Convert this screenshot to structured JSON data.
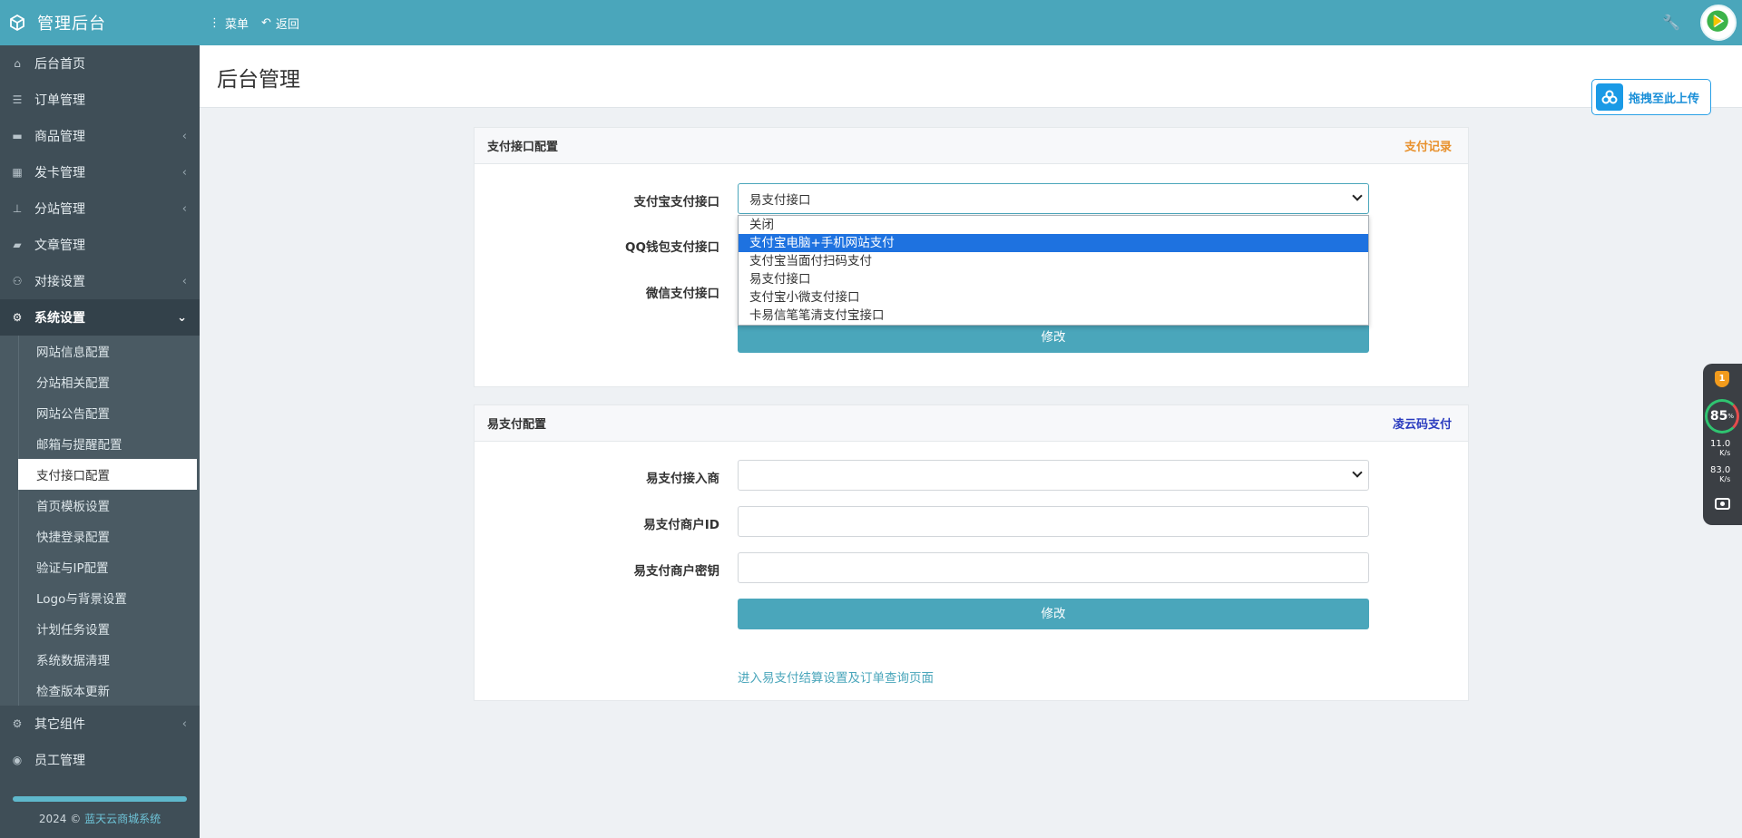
{
  "header": {
    "brand": "管理后台",
    "menu_label": "菜单",
    "back_label": "返回"
  },
  "sidebar": {
    "items_top": [
      {
        "label": "后台首页",
        "icon": "home-icon"
      },
      {
        "label": "订单管理",
        "icon": "list-icon"
      },
      {
        "label": "商品管理",
        "icon": "cart-icon",
        "expandable": true
      },
      {
        "label": "发卡管理",
        "icon": "grid-icon",
        "expandable": true
      },
      {
        "label": "分站管理",
        "icon": "sitemap-icon",
        "expandable": true
      },
      {
        "label": "文章管理",
        "icon": "book-icon"
      },
      {
        "label": "对接设置",
        "icon": "network-icon",
        "expandable": true
      },
      {
        "label": "系统设置",
        "icon": "gear-icon",
        "expanded": true
      }
    ],
    "sub_items": [
      "网站信息配置",
      "分站相关配置",
      "网站公告配置",
      "邮箱与提醒配置",
      "支付接口配置",
      "首页模板设置",
      "快捷登录配置",
      "验证与IP配置",
      "Logo与背景设置",
      "计划任务设置",
      "系统数据清理",
      "检查版本更新"
    ],
    "selected_sub": "支付接口配置",
    "items_bottom": [
      {
        "label": "其它组件",
        "icon": "cogs-icon",
        "expandable": true
      },
      {
        "label": "员工管理",
        "icon": "user-icon"
      }
    ],
    "footer_year": "2024 ©",
    "footer_link": "蓝天云商城系统"
  },
  "page": {
    "title": "后台管理",
    "upload_label": "拖拽至此上传"
  },
  "payment_panel": {
    "title": "支付接口配置",
    "link": "支付记录",
    "link_color": "#e8912d",
    "alipay_label": "支付宝支付接口",
    "alipay_value": "易支付接口",
    "qq_label": "QQ钱包支付接口",
    "wechat_label": "微信支付接口",
    "dropdown_options": [
      "关闭",
      "支付宝电脑+手机网站支付",
      "支付宝当面付扫码支付",
      "易支付接口",
      "支付宝小微支付接口",
      "卡易信笔笔清支付宝接口"
    ],
    "dropdown_highlighted": 1,
    "submit_label": "修改"
  },
  "epay_panel": {
    "title": "易支付配置",
    "link": "凌云码支付",
    "link_color": "#2a3bbf",
    "provider_label": "易支付接入商",
    "provider_value": "",
    "merchant_id_label": "易支付商户ID",
    "merchant_id_value": "",
    "merchant_key_label": "易支付商户密钥",
    "merchant_key_value": "",
    "submit_label": "修改",
    "settle_link": "进入易支付结算设置及订单查询页面"
  },
  "widget": {
    "score": "85",
    "score_unit": "%",
    "up_speed": "11.0",
    "down_speed": "83.0",
    "speed_unit": "K/s",
    "alert_count": "1"
  },
  "colors": {
    "header": "#4aa6bb",
    "sidebar": "#3f4e57",
    "accent": "#4aa6bb"
  }
}
